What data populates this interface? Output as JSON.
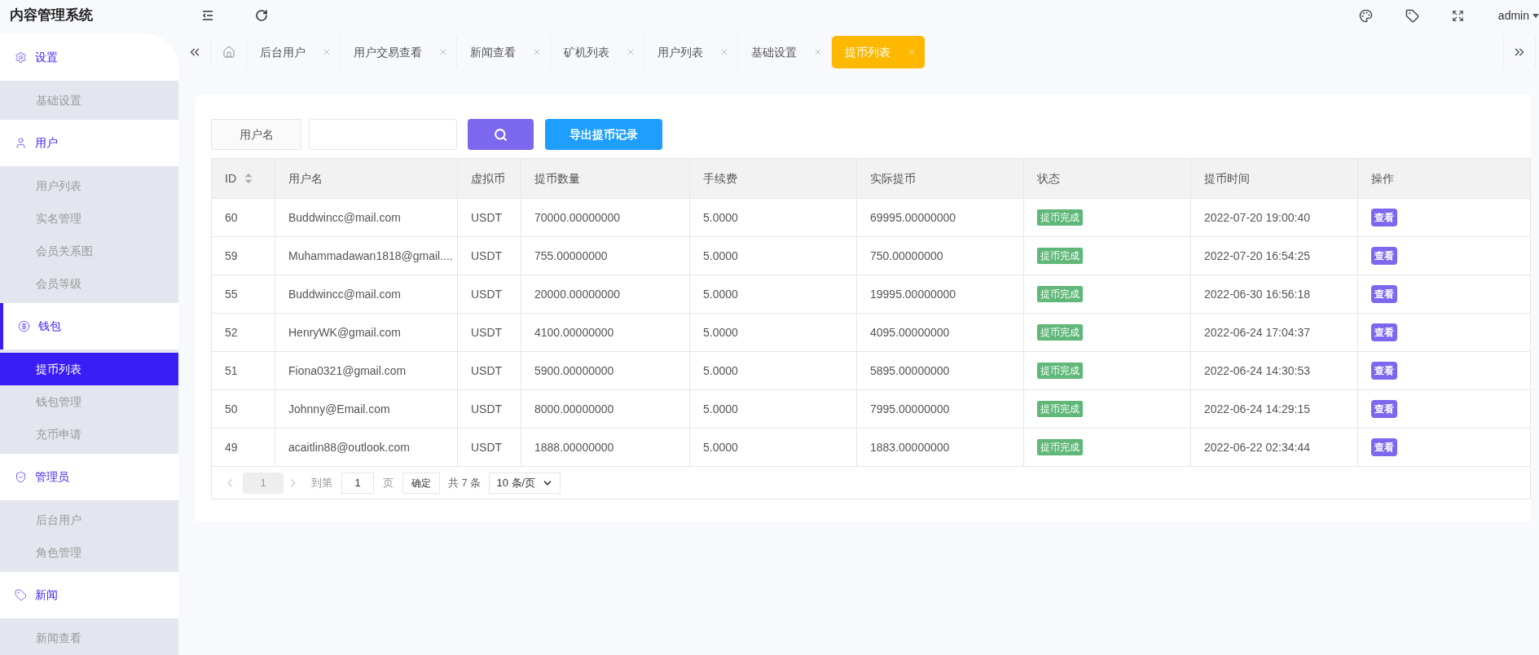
{
  "header": {
    "title": "内容管理系统",
    "user": "admin"
  },
  "sidebar": {
    "groups": [
      {
        "label": "设置",
        "active": false,
        "items": [
          {
            "label": "基础设置",
            "selected": false
          }
        ]
      },
      {
        "label": "用户",
        "active": false,
        "items": [
          {
            "label": "用户列表",
            "selected": false
          },
          {
            "label": "实名管理",
            "selected": false
          },
          {
            "label": "会员关系图",
            "selected": false
          },
          {
            "label": "会员等级",
            "selected": false
          }
        ]
      },
      {
        "label": "钱包",
        "active": true,
        "items": [
          {
            "label": "提币列表",
            "selected": true
          },
          {
            "label": "钱包管理",
            "selected": false
          },
          {
            "label": "充币申请",
            "selected": false
          }
        ]
      },
      {
        "label": "管理员",
        "active": false,
        "items": [
          {
            "label": "后台用户",
            "selected": false
          },
          {
            "label": "角色管理",
            "selected": false
          }
        ]
      },
      {
        "label": "新闻",
        "active": false,
        "items": [
          {
            "label": "新闻查看",
            "selected": false
          }
        ]
      }
    ]
  },
  "tabs": [
    {
      "label": "后台用户",
      "selected": false
    },
    {
      "label": "用户交易查看",
      "selected": false
    },
    {
      "label": "新闻查看",
      "selected": false
    },
    {
      "label": "矿机列表",
      "selected": false
    },
    {
      "label": "用户列表",
      "selected": false
    },
    {
      "label": "基础设置",
      "selected": false
    },
    {
      "label": "提币列表",
      "selected": true
    }
  ],
  "filter": {
    "label": "用户名",
    "export_button": "导出提币记录"
  },
  "table": {
    "columns": [
      {
        "label": "ID",
        "sortable": true
      },
      {
        "label": "用户名",
        "sortable": false
      },
      {
        "label": "虚拟币",
        "sortable": false
      },
      {
        "label": "提币数量",
        "sortable": false
      },
      {
        "label": "手续费",
        "sortable": false
      },
      {
        "label": "实际提币",
        "sortable": false
      },
      {
        "label": "状态",
        "sortable": false
      },
      {
        "label": "提币时间",
        "sortable": false
      },
      {
        "label": "操作",
        "sortable": false
      }
    ],
    "rows": [
      {
        "cells": [
          "60",
          "Buddwincc@mail.com",
          "USDT",
          "70000.00000000",
          "5.0000",
          "69995.00000000"
        ],
        "status": "提币完成",
        "time": "2022-07-20 19:00:40",
        "action": "查看"
      },
      {
        "cells": [
          "59",
          "Muhammadawan1818@gmail....",
          "USDT",
          "755.00000000",
          "5.0000",
          "750.00000000"
        ],
        "status": "提币完成",
        "time": "2022-07-20 16:54:25",
        "action": "查看"
      },
      {
        "cells": [
          "55",
          "Buddwincc@mail.com",
          "USDT",
          "20000.00000000",
          "5.0000",
          "19995.00000000"
        ],
        "status": "提币完成",
        "time": "2022-06-30 16:56:18",
        "action": "查看"
      },
      {
        "cells": [
          "52",
          "HenryWK@gmail.com",
          "USDT",
          "4100.00000000",
          "5.0000",
          "4095.00000000"
        ],
        "status": "提币完成",
        "time": "2022-06-24 17:04:37",
        "action": "查看"
      },
      {
        "cells": [
          "51",
          "Fiona0321@gmail.com",
          "USDT",
          "5900.00000000",
          "5.0000",
          "5895.00000000"
        ],
        "status": "提币完成",
        "time": "2022-06-24 14:30:53",
        "action": "查看"
      },
      {
        "cells": [
          "50",
          "Johnny@Email.com",
          "USDT",
          "8000.00000000",
          "5.0000",
          "7995.00000000"
        ],
        "status": "提币完成",
        "time": "2022-06-24 14:29:15",
        "action": "查看"
      },
      {
        "cells": [
          "49",
          "acaitlin88@outlook.com",
          "USDT",
          "1888.00000000",
          "5.0000",
          "1883.00000000"
        ],
        "status": "提币完成",
        "time": "2022-06-22 02:34:44",
        "action": "查看"
      }
    ]
  },
  "pagination": {
    "page": "1",
    "goto_label": "到第",
    "goto_value": "1",
    "page_unit": "页",
    "confirm": "确定",
    "total": "共 7 条",
    "page_size": "10 条/页"
  }
}
